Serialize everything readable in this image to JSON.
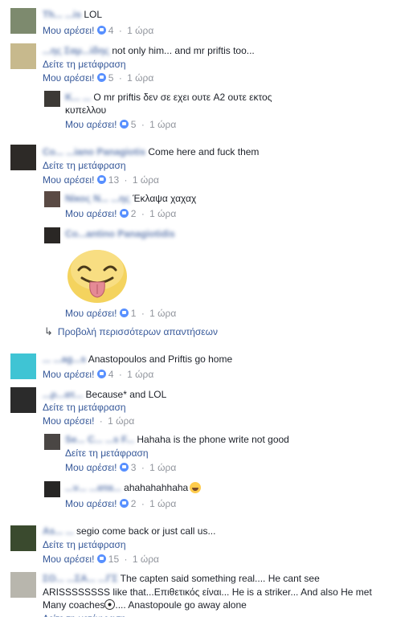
{
  "labels": {
    "like": "Μου αρέσει!",
    "translate": "Δείτε τη μετάφραση",
    "time": "1 ώρα",
    "view_more_replies": "Προβολή περισσότερων απαντήσεων",
    "separator": "·"
  },
  "comments": [
    {
      "author": "Th... ...is",
      "text": "LOL",
      "likes": "4"
    },
    {
      "author": "...ης Σαμ...ίδης",
      "text": "not only him... and mr priftis too...",
      "likes": "5"
    },
    {
      "author": "Κ... ...",
      "text": "Ο mr priftis δεν σε εχει ουτε A2 ουτε εκτος",
      "text2": "κυπελλου",
      "likes": "5"
    },
    {
      "author": "Co... ...iano Panagiotis",
      "text": "Come here and fuck them",
      "likes": "13"
    },
    {
      "author": "Νίκος Ν... ...ης",
      "text": "Έκλαψα χαχαχ",
      "likes": "2"
    },
    {
      "author": "Co...antino Panagiotidis",
      "text": "",
      "likes": "1"
    },
    {
      "author": "... ...ag...s",
      "text": "Anastopoulos and Priftis go home",
      "likes": "4"
    },
    {
      "author": "...ρ...ατ...",
      "text": "Because* and LOL",
      "likes": ""
    },
    {
      "author": "Se... C... ...s F...",
      "text": "Hahaha is the phone write not good",
      "likes": "3"
    },
    {
      "author": "...ν... ...ατα...",
      "text": "ahahahahhaha",
      "likes": "2"
    },
    {
      "author": "As... ...",
      "text": "segio come back or just call us...",
      "likes": "15"
    },
    {
      "author": "ΣΟ... ...ΣΑ... ...ΓΣ",
      "text": "The capten said something real.... He cant see",
      "text2": "ARISSSSSSSS like that...Επιθετικός είναι... He is a striker... And also He met",
      "text3": "Many coaches",
      "text4": ".... Anastopoule go away alone",
      "likes": ""
    }
  ]
}
